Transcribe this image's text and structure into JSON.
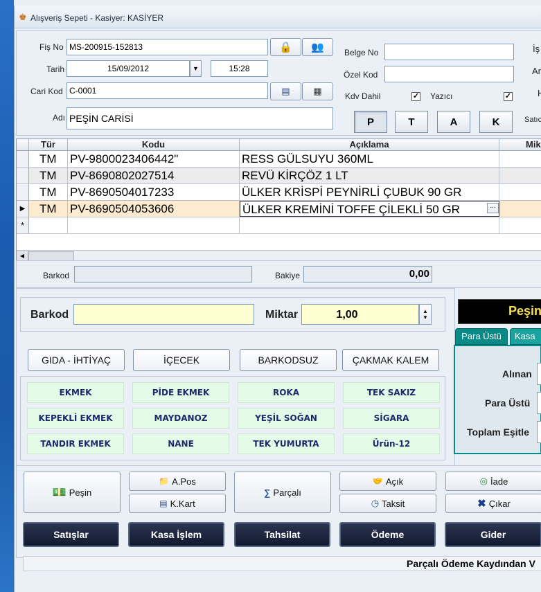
{
  "window": {
    "title": "Alışveriş Sepeti - Kasiyer: KASİYER"
  },
  "header": {
    "fis_no_label": "Fiş No",
    "fis_no": "MS-200915-152813",
    "tarih_label": "Tarih",
    "tarih": "15/09/2012",
    "saat": "15:28",
    "cari_kod_label": "Cari Kod",
    "cari_kod": "C-0001",
    "adi_label": "Adı",
    "adi": "PEŞİN CARİSİ",
    "belge_no_label": "Belge No",
    "belge_no": "",
    "ozel_kod_label": "Özel Kod",
    "ozel_kod": "",
    "kdv_dahil_label": "Kdv Dahil",
    "kdv_dahil_checked": true,
    "yazici_label": "Yazıcı",
    "yazici_checked": true,
    "right_labels": [
      "İş",
      "Ar",
      "H",
      "Satıc"
    ],
    "price_tabs": [
      "P",
      "T",
      "A",
      "K"
    ],
    "active_price_tab": "P"
  },
  "grid": {
    "columns": [
      "Tür",
      "Kodu",
      "Açıklama",
      "Mik"
    ],
    "rows": [
      {
        "tur": "TM",
        "kodu": "PV-9800023406442\"",
        "aciklama": "RESS GÜLSUYU 360ML"
      },
      {
        "tur": "TM",
        "kodu": "PV-8690802027514",
        "aciklama": "REVÜ KİRÇÖZ 1 LT"
      },
      {
        "tur": "TM",
        "kodu": "PV-8690504017233",
        "aciklama": "ÜLKER KRİSPİ  PEYNİRLİ ÇUBUK 90 GR"
      },
      {
        "tur": "TM",
        "kodu": "PV-8690504053606",
        "aciklama": "ÜLKER KREMİNİ TOFFE ÇİLEKLİ 50 GR"
      }
    ],
    "current_row_marker": "▶",
    "new_row_marker": "*",
    "ellipsis": "..."
  },
  "info": {
    "barkod_label": "Barkod",
    "bakiye_label": "Bakiye",
    "bakiye": "0,00"
  },
  "entry": {
    "barkod_label": "Barkod",
    "barkod": "",
    "miktar_label": "Miktar",
    "miktar": "1,00"
  },
  "categories": [
    "GIDA - İHTİYAÇ",
    "İÇECEK",
    "BARKODSUZ",
    "ÇAKMAK KALEM"
  ],
  "products": [
    [
      "EKMEK",
      "PİDE EKMEK",
      "ROKA",
      "TEK SAKIZ"
    ],
    [
      "KEPEKLİ EKMEK",
      "MAYDANOZ",
      "YEŞİL SOĞAN",
      "SİGARA"
    ],
    [
      "TANDIR EKMEK",
      "NANE",
      "TEK YUMURTA",
      "Ürün-12"
    ]
  ],
  "payment": {
    "title": "Peşin",
    "tabs": [
      "Para Üstü",
      "Kasa"
    ],
    "alinan_label": "Alınan",
    "para_ustu_label": "Para Üstü",
    "toplam_esitle_label": "Toplam Eşitle"
  },
  "actions": {
    "pesin": "Peşin",
    "apos": "A.Pos",
    "kkart": "K.Kart",
    "parcali": "Parçalı",
    "acik": "Açık",
    "taksit": "Taksit",
    "iade": "İade",
    "cikar": "Çıkar"
  },
  "menu": [
    "Satışlar",
    "Kasa İşlem",
    "Tahsilat",
    "Ödeme",
    "Gider"
  ],
  "status": {
    "text": "Parçalı Ödeme Kaydından V"
  }
}
